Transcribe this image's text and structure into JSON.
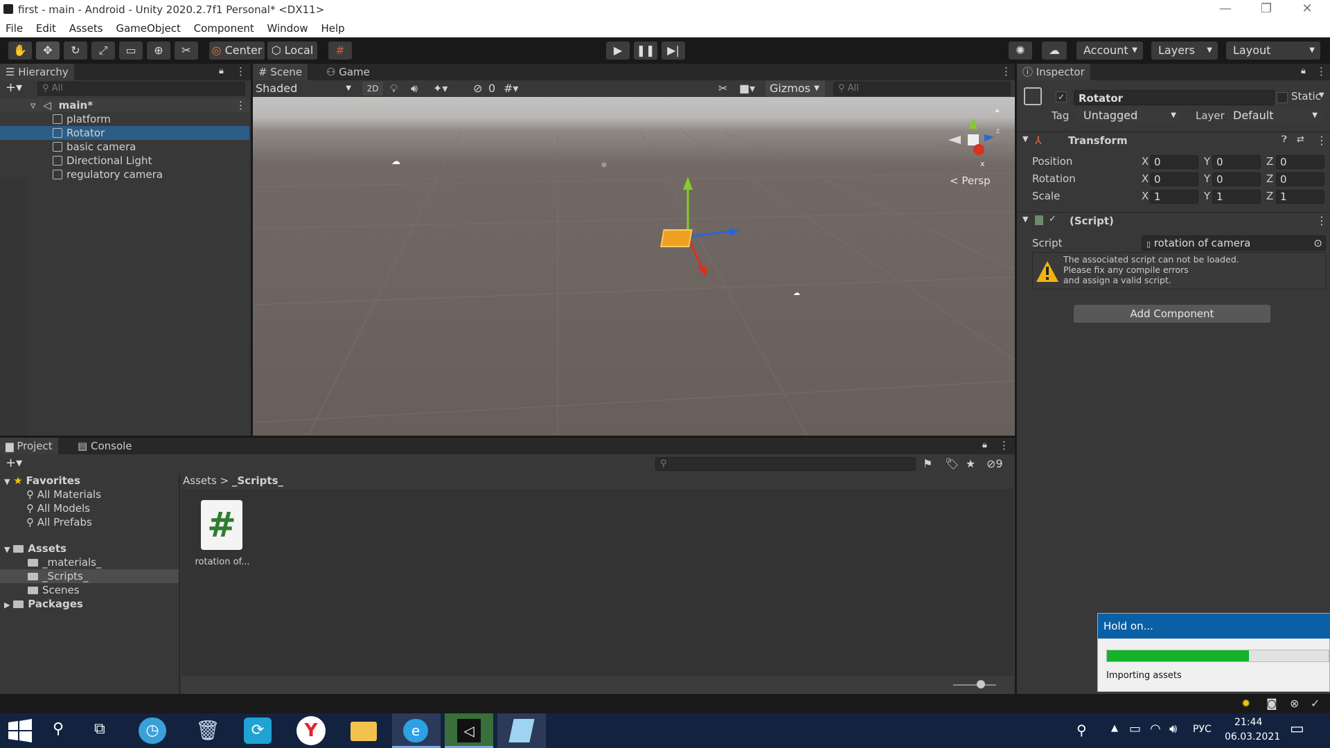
{
  "window": {
    "title": "first - main - Android - Unity 2020.2.7f1 Personal* <DX11>"
  },
  "menu": [
    "File",
    "Edit",
    "Assets",
    "GameObject",
    "Component",
    "Window",
    "Help"
  ],
  "toolbar": {
    "pivot": "Center",
    "space": "Local",
    "account": "Account",
    "layers": "Layers",
    "layout": "Layout"
  },
  "hierarchy": {
    "tab": "Hierarchy",
    "search_placeholder": "All",
    "scene": "main*",
    "items": [
      "platform",
      "Rotator",
      "basic camera",
      "Directional Light",
      "regulatory camera"
    ],
    "selected": "Rotator"
  },
  "scene": {
    "tabs": [
      "Scene",
      "Game"
    ],
    "shading": "Shaded",
    "mode2d": "2D",
    "hidden_count": "0",
    "gizmos": "Gizmos",
    "search_placeholder": "All",
    "persp": "Persp",
    "gizmo_axis_label": "x"
  },
  "inspector": {
    "tab": "Inspector",
    "name": "Rotator",
    "static": "Static",
    "tag_label": "Tag",
    "tag": "Untagged",
    "layer_label": "Layer",
    "layer": "Default",
    "transform_title": "Transform",
    "position_label": "Position",
    "rotation_label": "Rotation",
    "scale_label": "Scale",
    "axes": [
      "X",
      "Y",
      "Z"
    ],
    "position": [
      "0",
      "0",
      "0"
    ],
    "rotation": [
      "0",
      "0",
      "0"
    ],
    "scale": [
      "1",
      "1",
      "1"
    ],
    "script_component": "(Script)",
    "script_label": "Script",
    "script_value": "rotation of camera",
    "warning": "The associated script can not be loaded.\nPlease fix any compile errors\nand assign a valid script.",
    "add_component": "Add Component"
  },
  "project": {
    "tabs": [
      "Project",
      "Console"
    ],
    "favorites": "Favorites",
    "favorite_items": [
      "All Materials",
      "All Models",
      "All Prefabs"
    ],
    "assets": "Assets",
    "asset_folders": [
      "_materials_",
      "_Scripts_",
      "Scenes"
    ],
    "packages": "Packages",
    "breadcrumb": [
      "Assets",
      "_Scripts_"
    ],
    "hidden_count": "9",
    "file_label": "rotation of...",
    "file_glyph": "#"
  },
  "progress": {
    "title": "Hold on...",
    "label": "Importing assets",
    "value": 0.64,
    "color": "#15b32a"
  },
  "taskbar": {
    "time": "21:44",
    "date": "06.03.2021",
    "lang": "РУС"
  }
}
